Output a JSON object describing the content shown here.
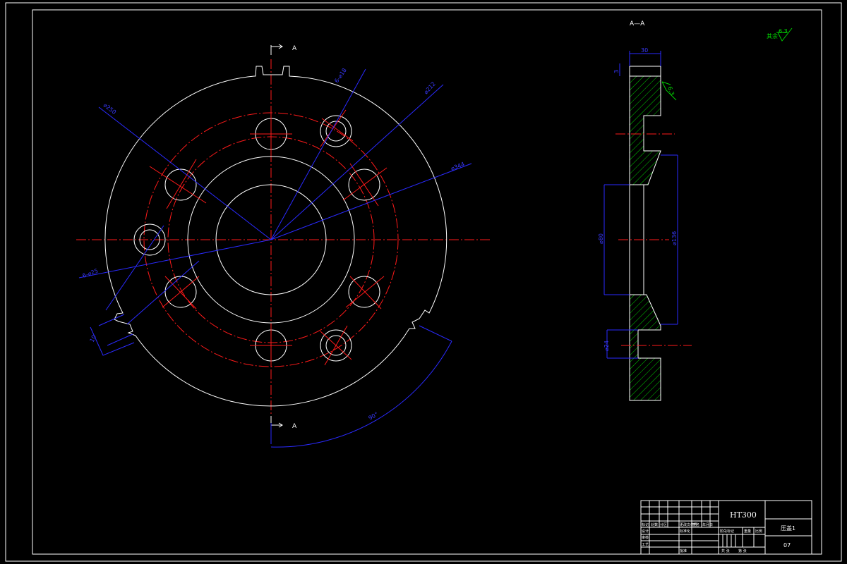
{
  "drawing": {
    "section_mark_top": "A",
    "section_mark_bottom": "A",
    "section_view_title": "A—A",
    "roughness_label": "其余",
    "roughness_value": "6.3",
    "section_roughness_value": "6.3"
  },
  "front_view_dims": {
    "d_250": "⌀250",
    "d_148": "6-⌀18",
    "d_212": "⌀212",
    "d_344": "⌀344",
    "d_h7": "6-⌀25",
    "slot_w": "10",
    "arc": "90°"
  },
  "section_view_dims": {
    "top_w": "30",
    "top_step": "3",
    "bore_d": "⌀80",
    "cone_d": "⌀136",
    "hole_d": "⌀24"
  },
  "title_block": {
    "material": "HT300",
    "part_name": "压盖1",
    "drawing_no": "07",
    "cells": [
      "标记",
      "处数",
      "分区",
      "更改文件号",
      "签名",
      "年月日",
      "设计",
      "标准化",
      "审核",
      "工艺",
      "批准",
      "阶段标记",
      "重量",
      "比例",
      "共 张",
      "第 张"
    ]
  },
  "colors": {
    "outline": "#ffffff",
    "center": "#ff1a1a",
    "dimension": "#2a2aff",
    "hatch": "#00cc00",
    "background": "#000000"
  }
}
